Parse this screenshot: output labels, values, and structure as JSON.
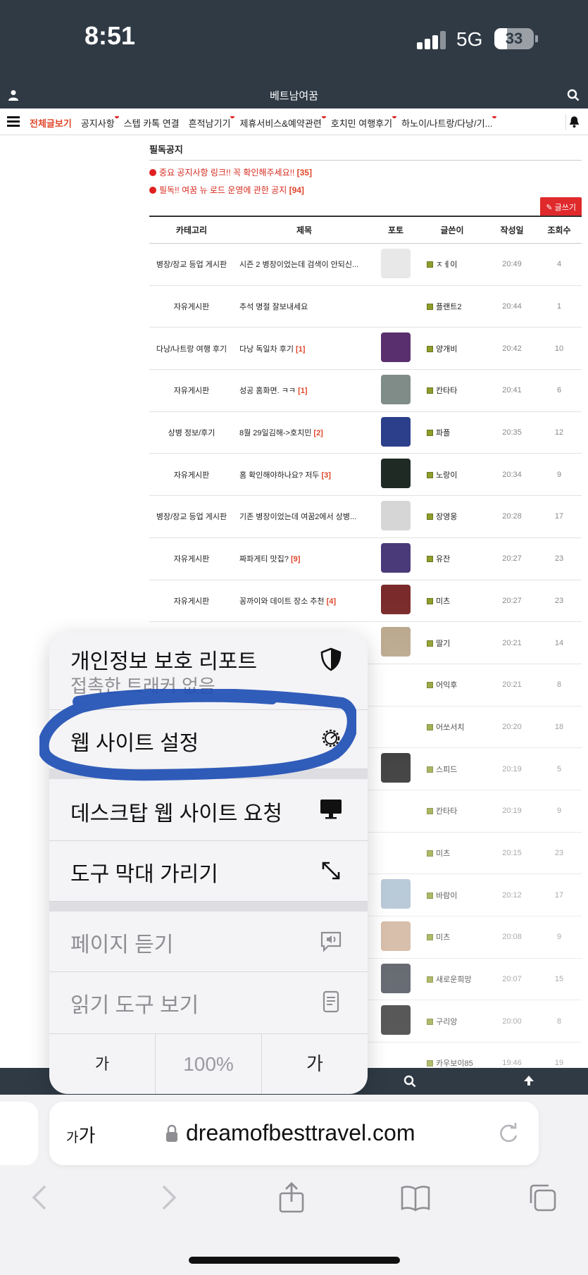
{
  "status_bar": {
    "time": "8:51",
    "network": "5G",
    "battery": "33",
    "battery_level": 0.33
  },
  "header": {
    "site_title": "베트남여꿈"
  },
  "nav": {
    "items": [
      {
        "label": "전체글보기",
        "active": true,
        "dot": false
      },
      {
        "label": "공지사항",
        "active": false,
        "dot": true
      },
      {
        "label": "스텝 카톡 연결",
        "active": false,
        "dot": false
      },
      {
        "label": "흔적남기기",
        "active": false,
        "dot": true
      },
      {
        "label": "제휴서비스&예약관련",
        "active": false,
        "dot": true
      },
      {
        "label": "호치민 여행후기",
        "active": false,
        "dot": true
      },
      {
        "label": "하노이/나트랑/다낭/기...",
        "active": false,
        "dot": true
      }
    ]
  },
  "notice": {
    "title": "필독공지",
    "items": [
      {
        "text": "중요 공지사항 링크!! 꼭 확인해주세요!!",
        "count": "[35]"
      },
      {
        "text": "필독!! 여꿈 뉴 로드 운영에 관한 공지",
        "count": "[94]"
      }
    ],
    "write_label": "글쓰기"
  },
  "board": {
    "headers": {
      "category": "카테고리",
      "title": "제목",
      "photo": "포토",
      "author": "글쓴이",
      "date": "작성일",
      "views": "조회수"
    },
    "rows": [
      {
        "category": "병장/장교 등업 게시판",
        "title": "시즌 2 병장이었는데 검색이 안되신...",
        "comments": "",
        "thumb": "#e8e8e8",
        "author": "ㅈㅔ이",
        "date": "20:49",
        "views": "4"
      },
      {
        "category": "자유게시판",
        "title": "추석 명절 잘보내세요",
        "comments": "",
        "thumb": "",
        "author": "플랜트2",
        "date": "20:44",
        "views": "1"
      },
      {
        "category": "다낭/나트랑 여행 후기",
        "title": "다낭 독일차 후기",
        "comments": "[1]",
        "thumb": "#5a2f6e",
        "author": "양개비",
        "date": "20:42",
        "views": "10"
      },
      {
        "category": "자유게시판",
        "title": "성공 홈화면. ㅋㅋ",
        "comments": "[1]",
        "thumb": "#7f8c88",
        "author": "칸타타",
        "date": "20:41",
        "views": "6"
      },
      {
        "category": "상병 정보/후기",
        "title": "8월 29일김해->호치민",
        "comments": "[2]",
        "thumb": "#2c3f8a",
        "author": "파플",
        "date": "20:35",
        "views": "12"
      },
      {
        "category": "자유게시판",
        "title": "홈 확인해야하나요? 저두",
        "comments": "[3]",
        "thumb": "#1f2a24",
        "author": "노랑이",
        "date": "20:34",
        "views": "9"
      },
      {
        "category": "병장/장교 등업 게시판",
        "title": "기존 병장이었는데 여꿈2에서 상병...",
        "comments": "",
        "thumb": "#d6d6d6",
        "author": "장영웅",
        "date": "20:28",
        "views": "17"
      },
      {
        "category": "자유게시판",
        "title": "짜파게티 맛집?",
        "comments": "[9]",
        "thumb": "#4b3a7a",
        "author": "유잔",
        "date": "20:27",
        "views": "23"
      },
      {
        "category": "자유게시판",
        "title": "꽁까이와 데이트 장소 추천",
        "comments": "[4]",
        "thumb": "#7a2a2a",
        "author": "미츠",
        "date": "20:27",
        "views": "23"
      },
      {
        "category": "",
        "title": "",
        "comments": "",
        "thumb": "#b8a58a",
        "author": "딸기",
        "date": "20:21",
        "views": "14"
      },
      {
        "category": "",
        "title": "",
        "comments": "",
        "thumb": "",
        "author": "어익후",
        "date": "20:21",
        "views": "8"
      },
      {
        "category": "",
        "title": "",
        "comments": "",
        "thumb": "",
        "author": "어쏘서치",
        "date": "20:20",
        "views": "18"
      },
      {
        "category": "",
        "title": "",
        "comments": "",
        "thumb": "#080808",
        "author": "스피드",
        "date": "20:19",
        "views": "5"
      },
      {
        "category": "",
        "title": "",
        "comments": "",
        "thumb": "",
        "author": "칸타타",
        "date": "20:19",
        "views": "9"
      },
      {
        "category": "",
        "title": "",
        "comments": "",
        "thumb": "",
        "author": "미츠",
        "date": "20:15",
        "views": "23"
      },
      {
        "category": "",
        "title": "",
        "comments": "",
        "thumb": "#9fb6c9",
        "author": "바람이",
        "date": "20:12",
        "views": "17"
      },
      {
        "category": "",
        "title": "",
        "comments": "",
        "thumb": "#c9a68a",
        "author": "미츠",
        "date": "20:08",
        "views": "9"
      },
      {
        "category": "",
        "title": "",
        "comments": "",
        "thumb": "#2a2f3a",
        "author": "새로운희망",
        "date": "20:07",
        "views": "15"
      },
      {
        "category": "",
        "title": "",
        "comments": "",
        "thumb": "#111111",
        "author": "구리앙",
        "date": "20:00",
        "views": "8"
      },
      {
        "category": "",
        "title": "",
        "comments": "",
        "thumb": "",
        "author": "카우보이85",
        "date": "19:46",
        "views": "19"
      }
    ]
  },
  "share_menu": {
    "privacy_report": "개인정보 보호 리포트",
    "privacy_sub": "접촉한 트래커 없음",
    "website_settings": "웹 사이트 설정",
    "request_desktop": "데스크탑 웹 사이트 요청",
    "hide_toolbar": "도구 막대 가리기",
    "listen_page": "페이지 듣기",
    "show_reader": "읽기 도구 보기",
    "font_smaller": "가",
    "zoom_level": "100%",
    "font_larger": "가"
  },
  "browser": {
    "aa_big": "가",
    "aa_small": "가",
    "url": "dreamofbesttravel.com"
  },
  "colors": {
    "header_bg": "#2f3a45",
    "accent_red": "#e0462a",
    "annotation_blue": "#1f4fb4"
  }
}
